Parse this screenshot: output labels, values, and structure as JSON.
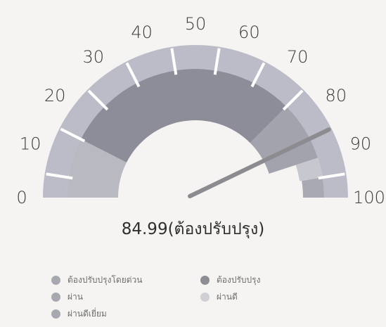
{
  "chart_data": {
    "type": "gauge",
    "min": 0,
    "max": 100,
    "value": 84.99,
    "value_text": "84.99(ต้องปรับปรุง)",
    "tick_labels": [
      "0",
      "10",
      "20",
      "30",
      "40",
      "50",
      "60",
      "70",
      "80",
      "90",
      "100"
    ],
    "bands": [
      {
        "from": 0,
        "to": 15,
        "label": "ต้องปรับปรุงโดยด่วน",
        "color": "#b9b9c2"
      },
      {
        "from": 15,
        "to": 75,
        "label": "ต้องปรับปรุง",
        "color": "#8d8c99"
      },
      {
        "from": 75,
        "to": 90,
        "label": "ผ่าน",
        "color": "#a3a3ad"
      },
      {
        "from": 90,
        "to": 95,
        "label": "ผ่านดี",
        "color": "#c7c7cf"
      },
      {
        "from": 95,
        "to": 100,
        "label": "ผ่านดีเยี่ยม",
        "color": "#a9a9b3"
      }
    ],
    "colors": {
      "outer_ring": "#bcbcc8",
      "needle": "#8b8b90",
      "ticks": "#ffffff"
    }
  },
  "legend": [
    {
      "label": "ต้องปรับปรุงโดยด่วน",
      "color": "#a8a8b0"
    },
    {
      "label": "ต้องปรับปรุง",
      "color": "#8d8d95"
    },
    {
      "label": "ผ่าน",
      "color": "#a8a8b0"
    },
    {
      "label": "ผ่านดี",
      "color": "#cfcfd4"
    },
    {
      "label": "ผ่านดีเยี่ยม",
      "color": "#a8a8b0"
    }
  ]
}
